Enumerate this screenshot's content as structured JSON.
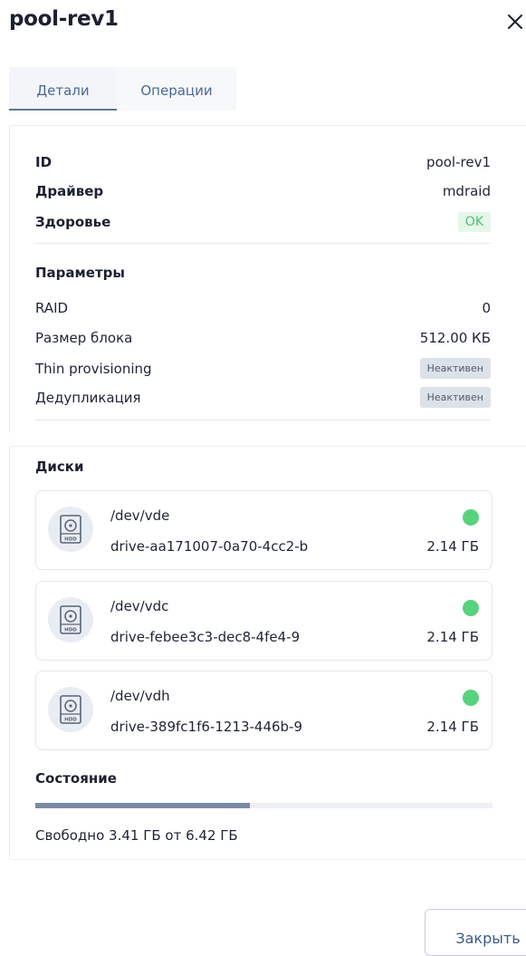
{
  "header": {
    "title": "pool-rev1",
    "close_icon": "close-icon"
  },
  "tabs": [
    {
      "label": "Детали",
      "active": true
    },
    {
      "label": "Операции",
      "active": false
    }
  ],
  "info": {
    "id_label": "ID",
    "id_value": "pool-rev1",
    "driver_label": "Драйвер",
    "driver_value": "mdraid",
    "health_label": "Здоровье",
    "health_value": "OK",
    "health_color": "#4cc26a"
  },
  "params": {
    "title": "Параметры",
    "raid_label": "RAID",
    "raid_value": "0",
    "block_label": "Размер блока",
    "block_value": "512.00 КБ",
    "thin_label": "Thin provisioning",
    "thin_value": "Неактивен",
    "dedup_label": "Дедупликация",
    "dedup_value": "Неактивен"
  },
  "disks": {
    "title": "Диски",
    "items": [
      {
        "dev": "/dev/vde",
        "drive": "drive-aa171007-0a70-4cc2-b",
        "size": "2.14 ГБ",
        "status_color": "#59d27d",
        "icon": "hdd-icon"
      },
      {
        "dev": "/dev/vdc",
        "drive": "drive-febee3c3-dec8-4fe4-9",
        "size": "2.14 ГБ",
        "status_color": "#59d27d",
        "icon": "hdd-icon"
      },
      {
        "dev": "/dev/vdh",
        "drive": "drive-389fc1f6-1213-446b-9",
        "size": "2.14 ГБ",
        "status_color": "#59d27d",
        "icon": "hdd-icon"
      }
    ]
  },
  "state": {
    "title": "Состояние",
    "used_fraction": 0.47,
    "free_text": "Свободно 3.41 ГБ от 6.42 ГБ"
  },
  "footer": {
    "close_button": "Закрыть"
  }
}
